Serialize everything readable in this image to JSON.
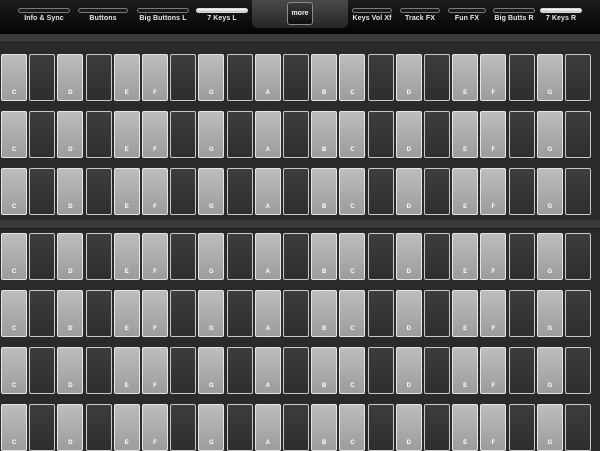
{
  "tabs": [
    {
      "label": "Info & Sync",
      "active": false
    },
    {
      "label": "Buttons",
      "active": false
    },
    {
      "label": "Big Buttons L",
      "active": false
    },
    {
      "label": "7 Keys L",
      "active": true
    },
    {
      "label": "Keys Vol Xf",
      "active": false
    },
    {
      "label": "Track FX",
      "active": false
    },
    {
      "label": "Fun FX",
      "active": false
    },
    {
      "label": "Big Butts R",
      "active": false
    },
    {
      "label": "7 Keys R",
      "active": true
    }
  ],
  "more_label": "more",
  "keyboard": {
    "rows": 7,
    "keys": [
      {
        "type": "white",
        "note": "C"
      },
      {
        "type": "black",
        "note": ""
      },
      {
        "type": "white",
        "note": "D"
      },
      {
        "type": "black",
        "note": ""
      },
      {
        "type": "white",
        "note": "E"
      },
      {
        "type": "white",
        "note": "F"
      },
      {
        "type": "black",
        "note": ""
      },
      {
        "type": "white",
        "note": "G"
      },
      {
        "type": "black",
        "note": ""
      },
      {
        "type": "white",
        "note": "A"
      },
      {
        "type": "black",
        "note": ""
      },
      {
        "type": "white",
        "note": "B"
      },
      {
        "type": "white",
        "note": "C"
      },
      {
        "type": "black",
        "note": ""
      },
      {
        "type": "white",
        "note": "D"
      },
      {
        "type": "black",
        "note": ""
      },
      {
        "type": "white",
        "note": "E"
      },
      {
        "type": "white",
        "note": "F"
      },
      {
        "type": "black",
        "note": ""
      },
      {
        "type": "white",
        "note": "G"
      },
      {
        "type": "black",
        "note": ""
      }
    ]
  },
  "colors": {
    "background": "#2a2a2a",
    "tabbar": "#0a0a0a",
    "white_key": "#a8a8a8",
    "black_key": "#343434",
    "key_border": "#e0e0e0"
  }
}
